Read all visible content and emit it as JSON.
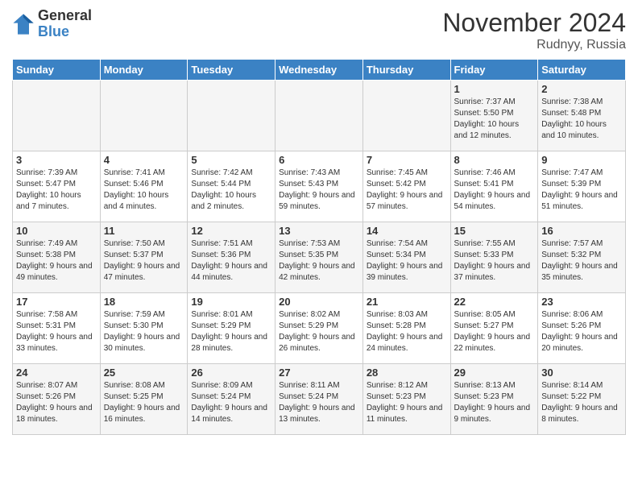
{
  "header": {
    "logo_line1": "General",
    "logo_line2": "Blue",
    "month": "November 2024",
    "location": "Rudnyy, Russia"
  },
  "days_of_week": [
    "Sunday",
    "Monday",
    "Tuesday",
    "Wednesday",
    "Thursday",
    "Friday",
    "Saturday"
  ],
  "weeks": [
    [
      {
        "day": "",
        "info": ""
      },
      {
        "day": "",
        "info": ""
      },
      {
        "day": "",
        "info": ""
      },
      {
        "day": "",
        "info": ""
      },
      {
        "day": "",
        "info": ""
      },
      {
        "day": "1",
        "info": "Sunrise: 7:37 AM\nSunset: 5:50 PM\nDaylight: 10 hours and 12 minutes."
      },
      {
        "day": "2",
        "info": "Sunrise: 7:38 AM\nSunset: 5:48 PM\nDaylight: 10 hours and 10 minutes."
      }
    ],
    [
      {
        "day": "3",
        "info": "Sunrise: 7:39 AM\nSunset: 5:47 PM\nDaylight: 10 hours and 7 minutes."
      },
      {
        "day": "4",
        "info": "Sunrise: 7:41 AM\nSunset: 5:46 PM\nDaylight: 10 hours and 4 minutes."
      },
      {
        "day": "5",
        "info": "Sunrise: 7:42 AM\nSunset: 5:44 PM\nDaylight: 10 hours and 2 minutes."
      },
      {
        "day": "6",
        "info": "Sunrise: 7:43 AM\nSunset: 5:43 PM\nDaylight: 9 hours and 59 minutes."
      },
      {
        "day": "7",
        "info": "Sunrise: 7:45 AM\nSunset: 5:42 PM\nDaylight: 9 hours and 57 minutes."
      },
      {
        "day": "8",
        "info": "Sunrise: 7:46 AM\nSunset: 5:41 PM\nDaylight: 9 hours and 54 minutes."
      },
      {
        "day": "9",
        "info": "Sunrise: 7:47 AM\nSunset: 5:39 PM\nDaylight: 9 hours and 51 minutes."
      }
    ],
    [
      {
        "day": "10",
        "info": "Sunrise: 7:49 AM\nSunset: 5:38 PM\nDaylight: 9 hours and 49 minutes."
      },
      {
        "day": "11",
        "info": "Sunrise: 7:50 AM\nSunset: 5:37 PM\nDaylight: 9 hours and 47 minutes."
      },
      {
        "day": "12",
        "info": "Sunrise: 7:51 AM\nSunset: 5:36 PM\nDaylight: 9 hours and 44 minutes."
      },
      {
        "day": "13",
        "info": "Sunrise: 7:53 AM\nSunset: 5:35 PM\nDaylight: 9 hours and 42 minutes."
      },
      {
        "day": "14",
        "info": "Sunrise: 7:54 AM\nSunset: 5:34 PM\nDaylight: 9 hours and 39 minutes."
      },
      {
        "day": "15",
        "info": "Sunrise: 7:55 AM\nSunset: 5:33 PM\nDaylight: 9 hours and 37 minutes."
      },
      {
        "day": "16",
        "info": "Sunrise: 7:57 AM\nSunset: 5:32 PM\nDaylight: 9 hours and 35 minutes."
      }
    ],
    [
      {
        "day": "17",
        "info": "Sunrise: 7:58 AM\nSunset: 5:31 PM\nDaylight: 9 hours and 33 minutes."
      },
      {
        "day": "18",
        "info": "Sunrise: 7:59 AM\nSunset: 5:30 PM\nDaylight: 9 hours and 30 minutes."
      },
      {
        "day": "19",
        "info": "Sunrise: 8:01 AM\nSunset: 5:29 PM\nDaylight: 9 hours and 28 minutes."
      },
      {
        "day": "20",
        "info": "Sunrise: 8:02 AM\nSunset: 5:29 PM\nDaylight: 9 hours and 26 minutes."
      },
      {
        "day": "21",
        "info": "Sunrise: 8:03 AM\nSunset: 5:28 PM\nDaylight: 9 hours and 24 minutes."
      },
      {
        "day": "22",
        "info": "Sunrise: 8:05 AM\nSunset: 5:27 PM\nDaylight: 9 hours and 22 minutes."
      },
      {
        "day": "23",
        "info": "Sunrise: 8:06 AM\nSunset: 5:26 PM\nDaylight: 9 hours and 20 minutes."
      }
    ],
    [
      {
        "day": "24",
        "info": "Sunrise: 8:07 AM\nSunset: 5:26 PM\nDaylight: 9 hours and 18 minutes."
      },
      {
        "day": "25",
        "info": "Sunrise: 8:08 AM\nSunset: 5:25 PM\nDaylight: 9 hours and 16 minutes."
      },
      {
        "day": "26",
        "info": "Sunrise: 8:09 AM\nSunset: 5:24 PM\nDaylight: 9 hours and 14 minutes."
      },
      {
        "day": "27",
        "info": "Sunrise: 8:11 AM\nSunset: 5:24 PM\nDaylight: 9 hours and 13 minutes."
      },
      {
        "day": "28",
        "info": "Sunrise: 8:12 AM\nSunset: 5:23 PM\nDaylight: 9 hours and 11 minutes."
      },
      {
        "day": "29",
        "info": "Sunrise: 8:13 AM\nSunset: 5:23 PM\nDaylight: 9 hours and 9 minutes."
      },
      {
        "day": "30",
        "info": "Sunrise: 8:14 AM\nSunset: 5:22 PM\nDaylight: 9 hours and 8 minutes."
      }
    ]
  ]
}
